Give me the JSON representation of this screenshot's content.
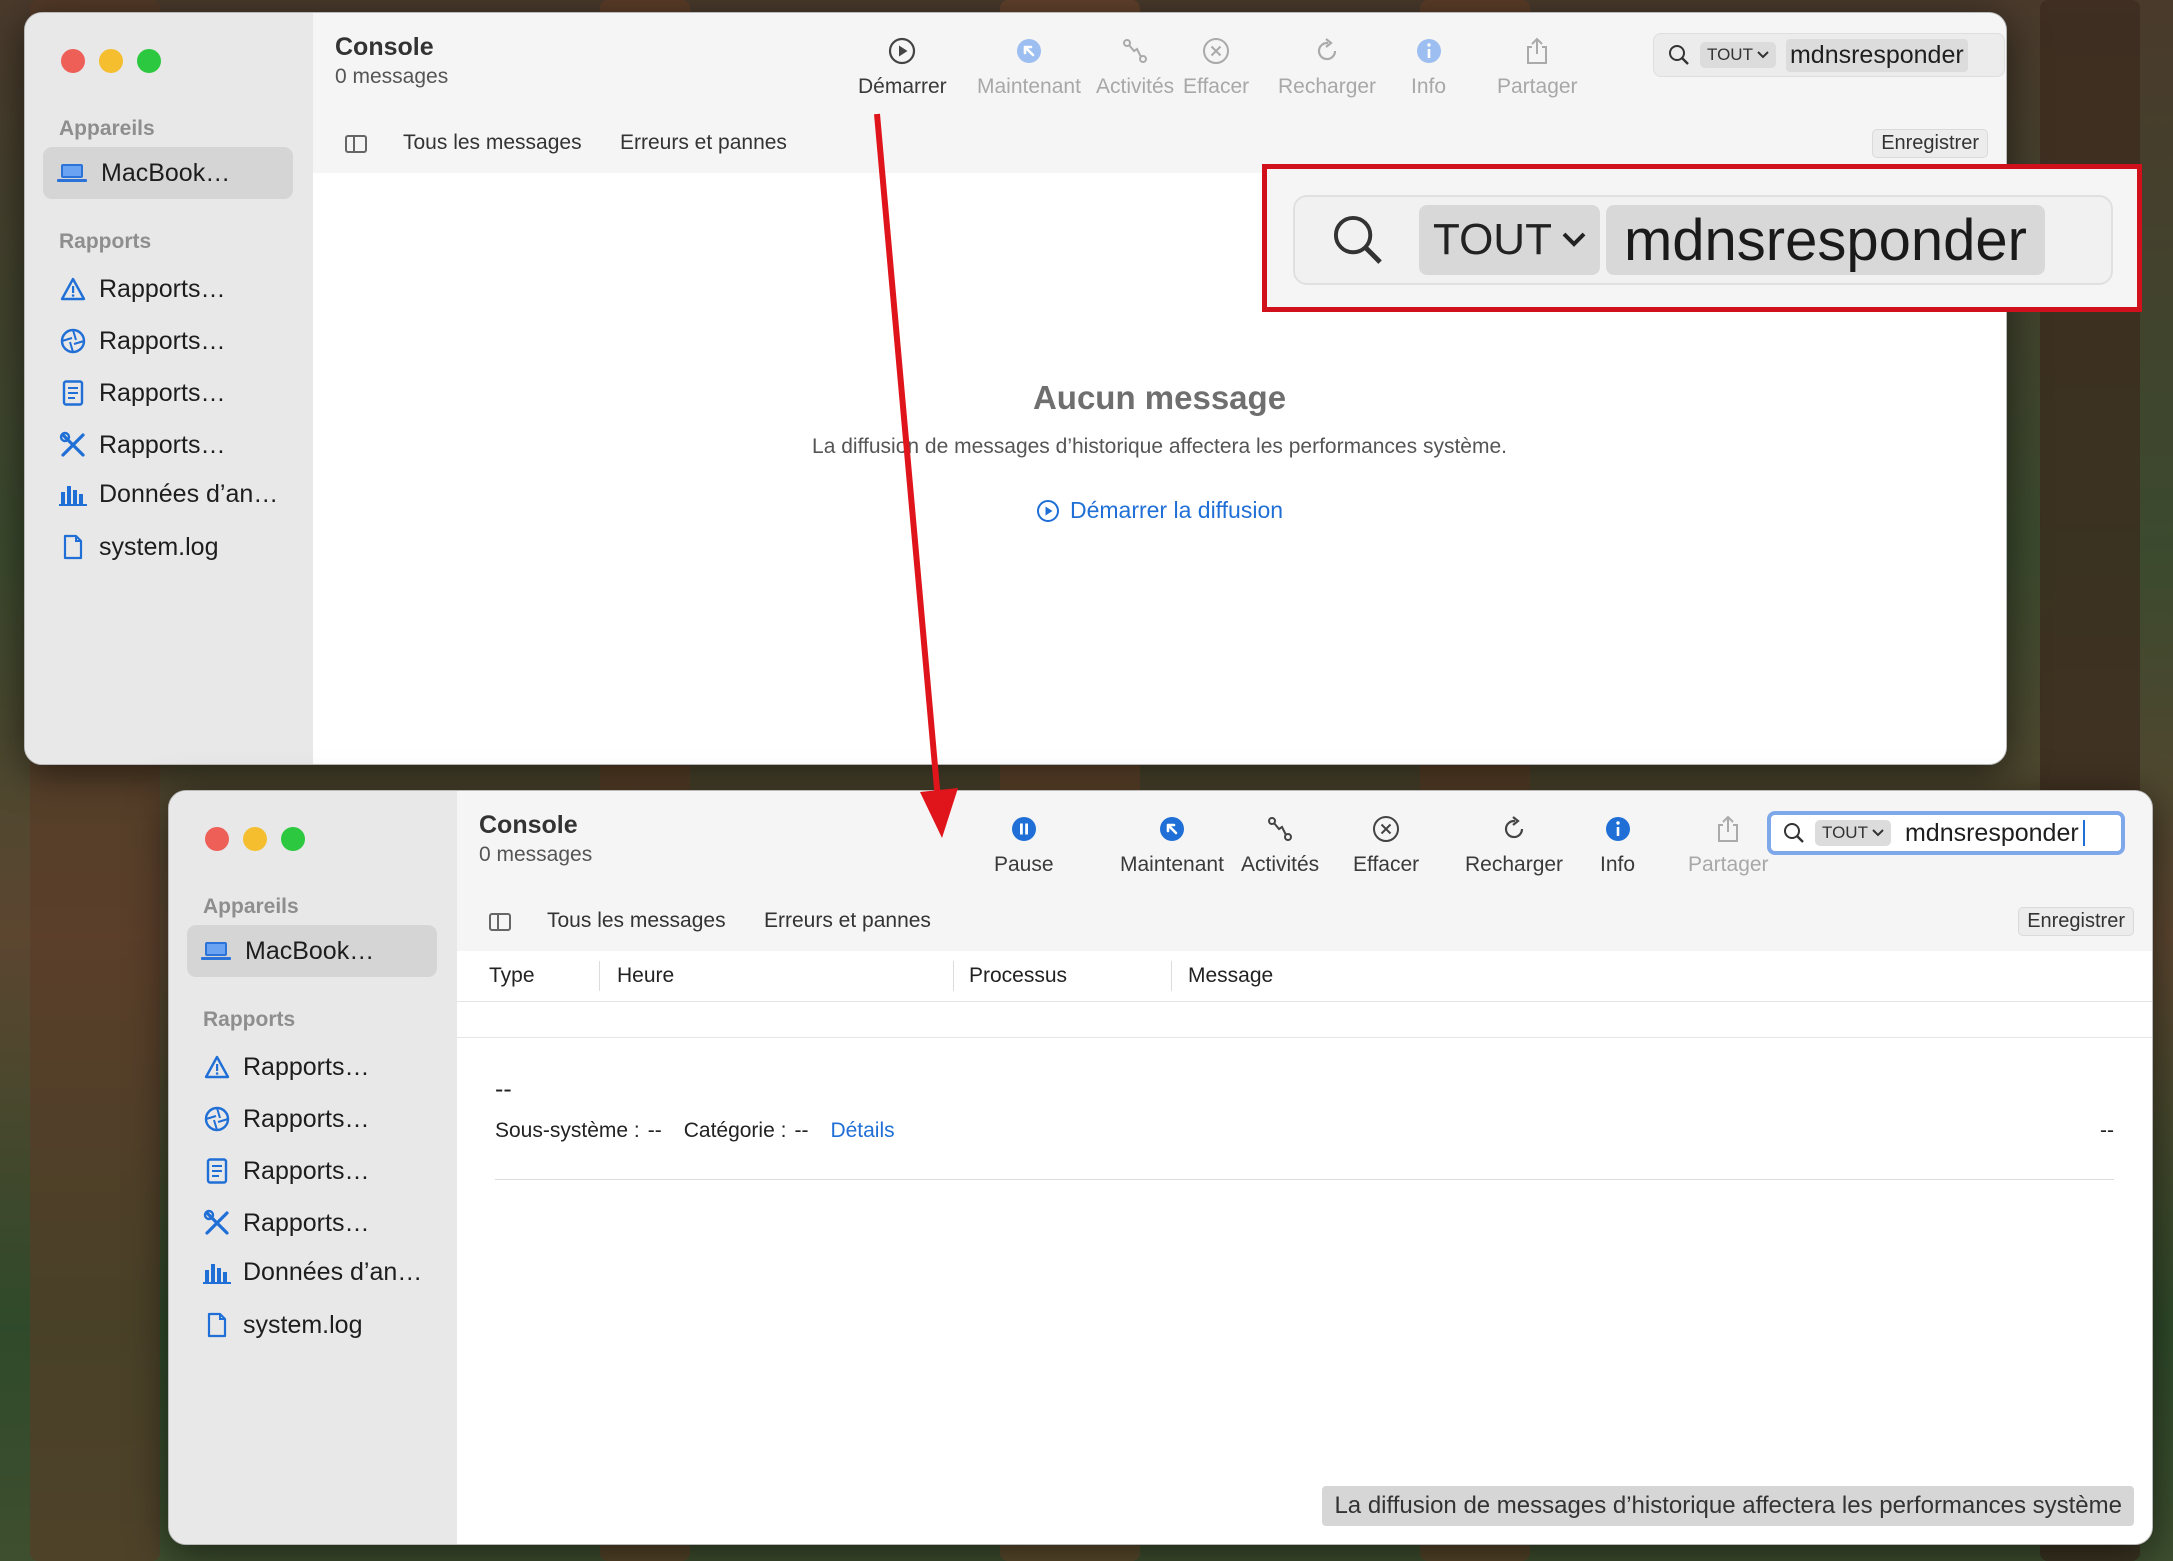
{
  "colors": {
    "accent": "#1f6fd6",
    "highlight_red": "#d0101a",
    "arrow_red": "#e0141b"
  },
  "sidebar": {
    "section_devices": "Appareils",
    "device": "MacBook…",
    "section_reports": "Rapports",
    "reports": [
      {
        "label": "Rapports…",
        "icon": "warning-triangle-icon"
      },
      {
        "label": "Rapports…",
        "icon": "aperture-icon"
      },
      {
        "label": "Rapports…",
        "icon": "document-icon"
      },
      {
        "label": "Rapports…",
        "icon": "tools-icon"
      },
      {
        "label": "Données d’an…",
        "icon": "bar-chart-icon"
      },
      {
        "label": "system.log",
        "icon": "file-icon"
      }
    ]
  },
  "win1": {
    "title": "Console",
    "subtitle": "0 messages",
    "toolbar": {
      "start": "Démarrer",
      "now": "Maintenant",
      "activities": "Activités",
      "clear": "Effacer",
      "reload": "Recharger",
      "info": "Info",
      "share": "Partager"
    },
    "search": {
      "scope": "TOUT",
      "query": "mdnsresponder"
    },
    "tabs": {
      "all": "Tous les messages",
      "errors": "Erreurs et pannes",
      "save": "Enregistrer"
    },
    "empty": {
      "title": "Aucun message",
      "desc": "La diffusion de messages d’historique affectera les performances système.",
      "action": "Démarrer la diffusion"
    },
    "zoom": {
      "scope": "TOUT",
      "query": "mdnsresponder"
    }
  },
  "win2": {
    "title": "Console",
    "subtitle": "0 messages",
    "toolbar": {
      "pause": "Pause",
      "now": "Maintenant",
      "activities": "Activités",
      "clear": "Effacer",
      "reload": "Recharger",
      "info": "Info",
      "share": "Partager"
    },
    "search": {
      "scope": "TOUT",
      "query": "mdnsresponder"
    },
    "tabs": {
      "all": "Tous les messages",
      "errors": "Erreurs et pannes",
      "save": "Enregistrer"
    },
    "columns": [
      "Type",
      "Heure",
      "Processus",
      "Message"
    ],
    "detail": {
      "dash": "--",
      "subsystem_label": "Sous-système :",
      "subsystem_value": "--",
      "category_label": "Catégorie :",
      "category_value": "--",
      "details_link": "Détails",
      "right_value": "--"
    },
    "status": "La diffusion de messages d’historique affectera les performances système"
  }
}
